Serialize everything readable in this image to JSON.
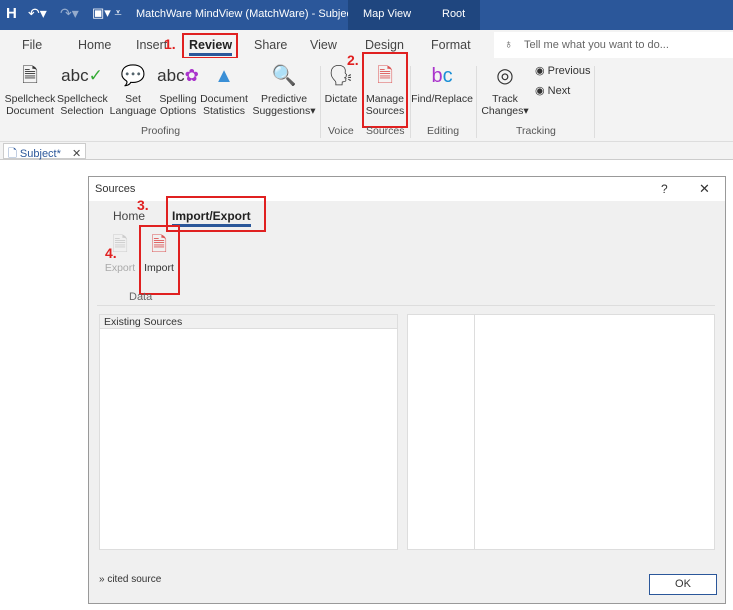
{
  "titlebar": {
    "title": "MatchWare MindView (MatchWare) - Subject",
    "context_tabs": [
      "Map View",
      "Root"
    ],
    "icons": [
      "save-icon",
      "undo-icon",
      "redo-icon",
      "customize-icon"
    ]
  },
  "tabs": [
    "File",
    "Home",
    "Insert",
    "Review",
    "Share",
    "View",
    "Design",
    "Format"
  ],
  "active_tab": "Review",
  "tell_me": {
    "placeholder": "Tell me what you want to do..."
  },
  "ribbon": {
    "proofing": {
      "label": "Proofing",
      "buttons": [
        [
          "Spellcheck",
          "Document"
        ],
        [
          "Spellcheck",
          "Selection"
        ],
        [
          "Set",
          "Language"
        ],
        [
          "Spelling",
          "Options"
        ],
        [
          "Document",
          "Statistics"
        ],
        [
          "Predictive",
          "Suggestions"
        ]
      ]
    },
    "voice": {
      "label": "Voice",
      "button": "Dictate"
    },
    "sources": {
      "label": "Sources",
      "button": [
        "Manage",
        "Sources"
      ]
    },
    "editing": {
      "label": "Editing",
      "button": "Find/Replace"
    },
    "tracking": {
      "label": "Tracking",
      "button": [
        "Track",
        "Changes"
      ],
      "previous": "Previous",
      "next": "Next"
    }
  },
  "doc_tab": {
    "label": "Subject*"
  },
  "annotations": [
    "1.",
    "2.",
    "3.",
    "4."
  ],
  "accent": "#2b579a",
  "annotation_color": "#e02020",
  "dialog": {
    "title": "Sources",
    "help": "?",
    "tabs": [
      "Home",
      "Import/Export"
    ],
    "active_tab": "Import/Export",
    "export": "Export",
    "import": "Import",
    "group": "Data",
    "list_header": "Existing Sources",
    "footer": "» cited source",
    "ok": "OK"
  }
}
